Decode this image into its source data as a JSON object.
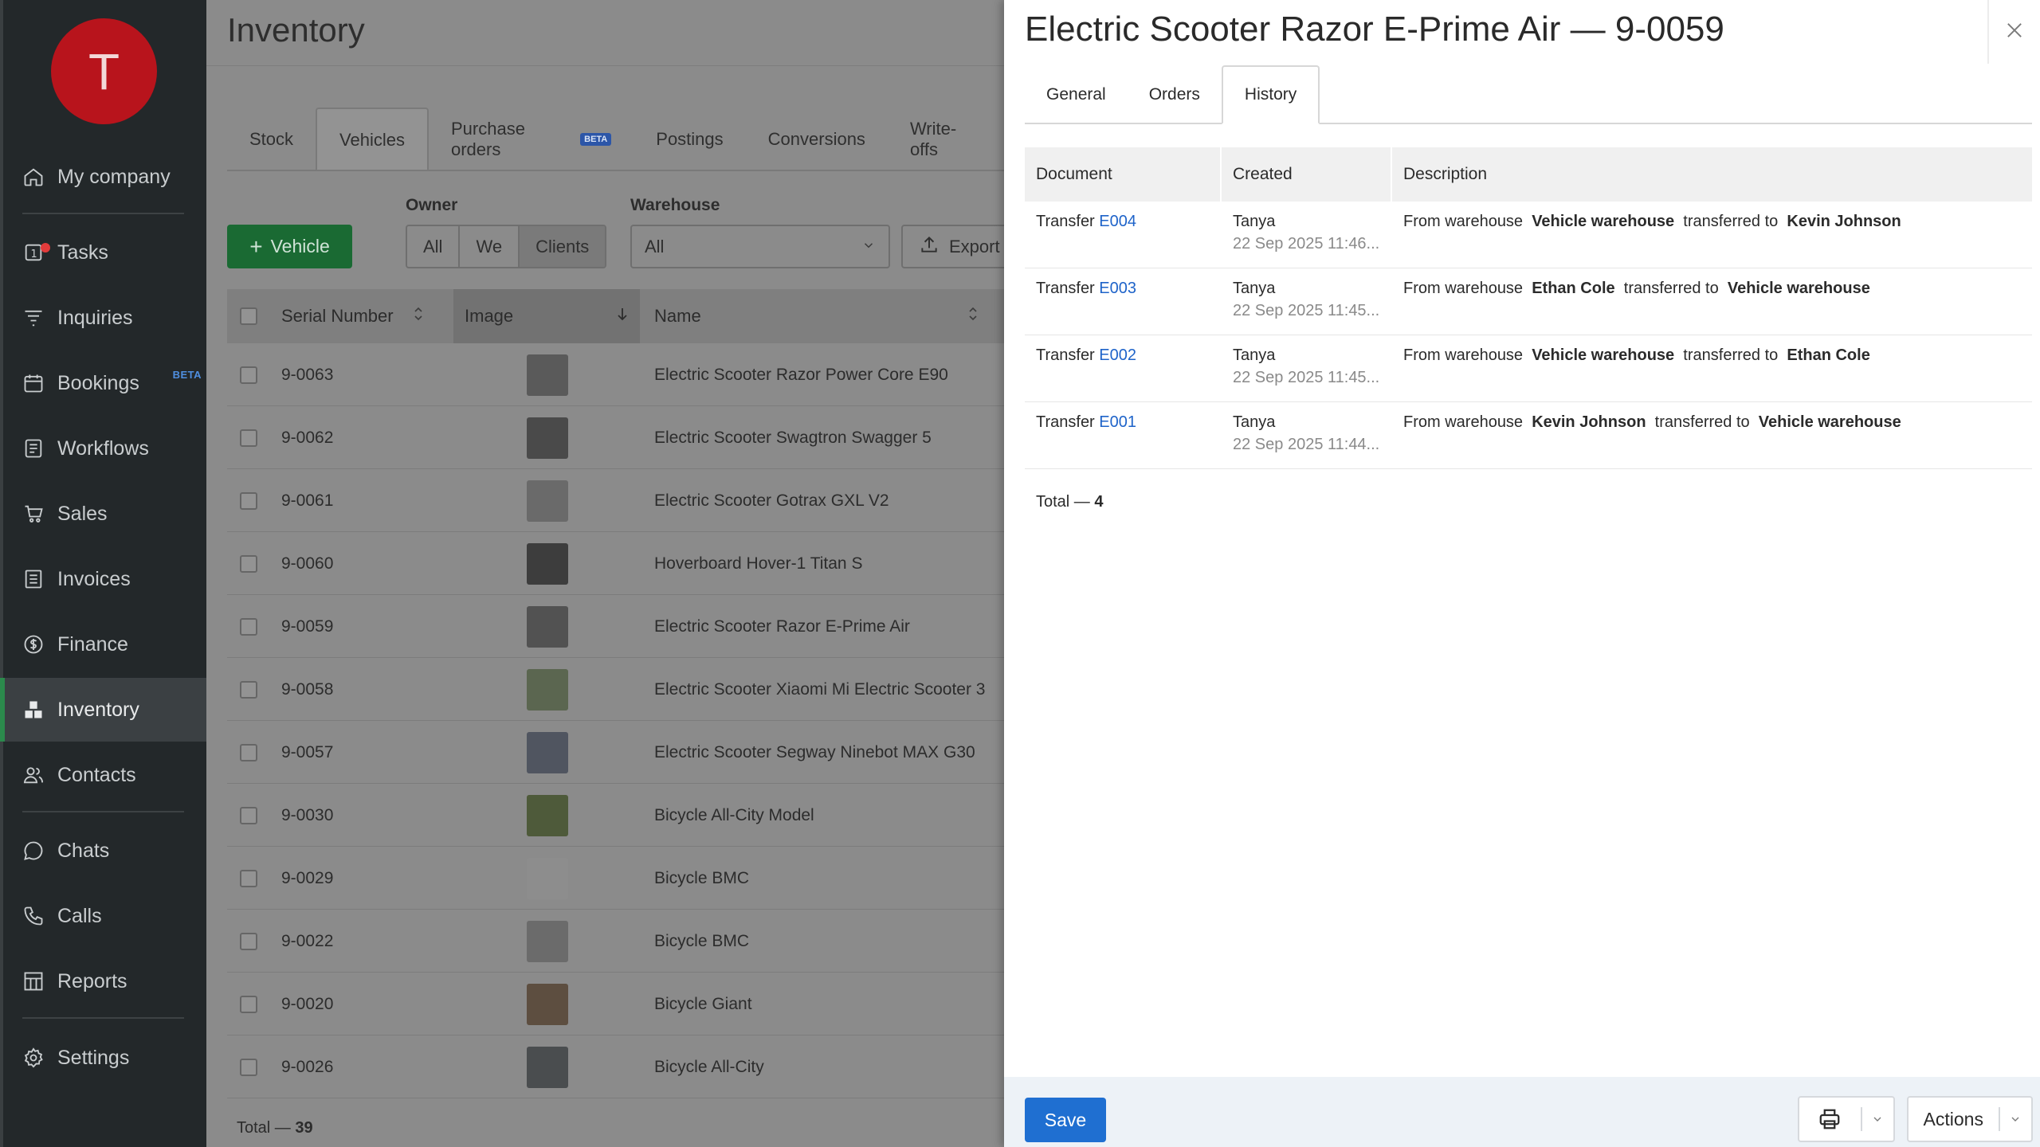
{
  "sidebar": {
    "avatar_letter": "T",
    "items": [
      {
        "label": "My company",
        "icon": "home-icon"
      },
      {
        "label": "Tasks",
        "icon": "tasks-icon",
        "badge": "1"
      },
      {
        "label": "Inquiries",
        "icon": "funnel-icon"
      },
      {
        "label": "Bookings",
        "icon": "calendar-icon",
        "tag": "BETA"
      },
      {
        "label": "Workflows",
        "icon": "workflow-icon"
      },
      {
        "label": "Sales",
        "icon": "cart-icon"
      },
      {
        "label": "Invoices",
        "icon": "invoice-icon"
      },
      {
        "label": "Finance",
        "icon": "dollar-icon"
      },
      {
        "label": "Inventory",
        "icon": "boxes-icon",
        "active": true
      },
      {
        "label": "Contacts",
        "icon": "contacts-icon"
      },
      {
        "label": "Chats",
        "icon": "chat-icon"
      },
      {
        "label": "Calls",
        "icon": "phone-icon"
      },
      {
        "label": "Reports",
        "icon": "reports-icon"
      },
      {
        "label": "Settings",
        "icon": "gear-icon"
      }
    ]
  },
  "main": {
    "title": "Inventory",
    "tabs": [
      "Stock",
      "Vehicles",
      "Purchase orders",
      "Postings",
      "Conversions",
      "Write-offs"
    ],
    "active_tab": "Vehicles",
    "beta_badge": "BETA",
    "add_button": "Vehicle",
    "owner_label": "Owner",
    "owner_options": [
      "All",
      "We",
      "Clients"
    ],
    "owner_selected": "Clients",
    "warehouse_label": "Warehouse",
    "warehouse_value": "All",
    "export_label": "Export",
    "columns": [
      "Serial Number",
      "Image",
      "Name"
    ],
    "rows": [
      {
        "serial": "9-0063",
        "name": "Electric Scooter Razor Power Core E90"
      },
      {
        "serial": "9-0062",
        "name": "Electric Scooter Swagtron Swagger 5"
      },
      {
        "serial": "9-0061",
        "name": "Electric Scooter Gotrax GXL V2"
      },
      {
        "serial": "9-0060",
        "name": "Hoverboard Hover-1 Titan S"
      },
      {
        "serial": "9-0059",
        "name": "Electric Scooter Razor E-Prime Air"
      },
      {
        "serial": "9-0058",
        "name": "Electric Scooter Xiaomi Mi Electric Scooter 3"
      },
      {
        "serial": "9-0057",
        "name": "Electric Scooter Segway Ninebot MAX G30"
      },
      {
        "serial": "9-0030",
        "name": "Bicycle All-City Model"
      },
      {
        "serial": "9-0029",
        "name": "Bicycle BMC"
      },
      {
        "serial": "9-0022",
        "name": "Bicycle BMC"
      },
      {
        "serial": "9-0020",
        "name": "Bicycle Giant"
      },
      {
        "serial": "9-0026",
        "name": "Bicycle All-City"
      }
    ],
    "total_label": "Total —",
    "total_value": "39"
  },
  "drawer": {
    "title": "Electric Scooter Razor E-Prime Air — 9-0059",
    "tabs": [
      "General",
      "Orders",
      "History"
    ],
    "active_tab": "History",
    "columns": [
      "Document",
      "Created",
      "Description"
    ],
    "history": [
      {
        "doc_prefix": "Transfer",
        "doc_link": "E004",
        "user": "Tanya",
        "time": "22 Sep 2025 11:46...",
        "d1": "From warehouse",
        "from": "Vehicle warehouse",
        "d2": "transferred to",
        "to": "Kevin Johnson"
      },
      {
        "doc_prefix": "Transfer",
        "doc_link": "E003",
        "user": "Tanya",
        "time": "22 Sep 2025 11:45...",
        "d1": "From warehouse",
        "from": "Ethan Cole",
        "d2": "transferred to",
        "to": "Vehicle warehouse"
      },
      {
        "doc_prefix": "Transfer",
        "doc_link": "E002",
        "user": "Tanya",
        "time": "22 Sep 2025 11:45...",
        "d1": "From warehouse",
        "from": "Vehicle warehouse",
        "d2": "transferred to",
        "to": "Ethan Cole"
      },
      {
        "doc_prefix": "Transfer",
        "doc_link": "E001",
        "user": "Tanya",
        "time": "22 Sep 2025 11:44...",
        "d1": "From warehouse",
        "from": "Kevin Johnson",
        "d2": "transferred to",
        "to": "Vehicle warehouse"
      }
    ],
    "total_label": "Total —",
    "total_value": "4",
    "save_label": "Save",
    "actions_label": "Actions"
  },
  "colors": {
    "sidebar_bg": "#23282a",
    "avatar": "#b8141c",
    "primary_green": "#1a6a33",
    "link_blue": "#1e63c9",
    "save_blue": "#1f6fd1"
  }
}
